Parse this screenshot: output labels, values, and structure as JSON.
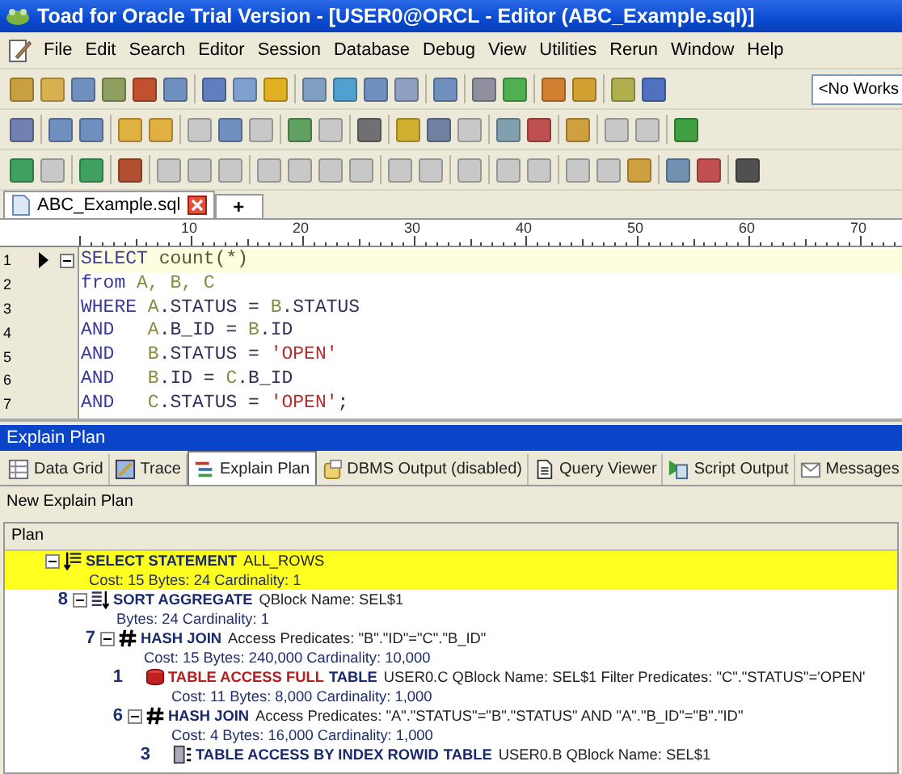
{
  "window": {
    "title": "Toad for Oracle Trial Version - [USER0@ORCL - Editor (ABC_Example.sql)]"
  },
  "menu": [
    "File",
    "Edit",
    "Search",
    "Editor",
    "Session",
    "Database",
    "Debug",
    "View",
    "Utilities",
    "Rerun",
    "Window",
    "Help"
  ],
  "workspace_combo": {
    "value": "<No Works"
  },
  "editor_tabs": [
    {
      "label": "ABC_Example.sql",
      "selected": true
    }
  ],
  "new_tab": {
    "label": "+"
  },
  "ruler": [
    "10",
    "20",
    "30",
    "40",
    "50",
    "60",
    "70"
  ],
  "sql_lines": [
    {
      "number": "1",
      "current": true,
      "tokens": [
        {
          "t": "SELECT",
          "kind": "kw"
        },
        {
          "t": " count(*)",
          "kind": "fn"
        }
      ]
    },
    {
      "number": "2",
      "current": false,
      "tokens": [
        {
          "t": "from",
          "kind": "kw"
        },
        {
          "t": " A, B, C",
          "kind": "id"
        }
      ]
    },
    {
      "number": "3",
      "current": false,
      "tokens": [
        {
          "t": "WHERE",
          "kind": "kw"
        },
        {
          "t": " A",
          "kind": "id"
        },
        {
          "t": ".STATUS = ",
          "kind": "col"
        },
        {
          "t": "B",
          "kind": "id"
        },
        {
          "t": ".STATUS",
          "kind": "col"
        }
      ]
    },
    {
      "number": "4",
      "current": false,
      "tokens": [
        {
          "t": "AND",
          "kind": "kw"
        },
        {
          "t": "   A",
          "kind": "id"
        },
        {
          "t": ".B_ID = ",
          "kind": "col"
        },
        {
          "t": "B",
          "kind": "id"
        },
        {
          "t": ".ID",
          "kind": "col"
        }
      ]
    },
    {
      "number": "5",
      "current": false,
      "tokens": [
        {
          "t": "AND",
          "kind": "kw"
        },
        {
          "t": "   B",
          "kind": "id"
        },
        {
          "t": ".STATUS = ",
          "kind": "col"
        },
        {
          "t": "'OPEN'",
          "kind": "str"
        }
      ]
    },
    {
      "number": "6",
      "current": false,
      "tokens": [
        {
          "t": "AND",
          "kind": "kw"
        },
        {
          "t": "   B",
          "kind": "id"
        },
        {
          "t": ".ID = ",
          "kind": "col"
        },
        {
          "t": "C",
          "kind": "id"
        },
        {
          "t": ".B_ID",
          "kind": "col"
        }
      ]
    },
    {
      "number": "7",
      "current": false,
      "tokens": [
        {
          "t": "AND",
          "kind": "kw"
        },
        {
          "t": "   C",
          "kind": "id"
        },
        {
          "t": ".STATUS = ",
          "kind": "col"
        },
        {
          "t": "'OPEN'",
          "kind": "str"
        },
        {
          "t": ";",
          "kind": "col"
        }
      ]
    }
  ],
  "panel": {
    "title": "Explain Plan"
  },
  "result_tabs": [
    {
      "label": "Data Grid",
      "selected": false,
      "kind": "grid"
    },
    {
      "label": "Trace",
      "selected": false,
      "kind": "trace"
    },
    {
      "label": "Explain Plan",
      "selected": true,
      "kind": "plan"
    },
    {
      "label": "DBMS Output (disabled)",
      "selected": false,
      "kind": "dbms"
    },
    {
      "label": "Query Viewer",
      "selected": false,
      "kind": "doc"
    },
    {
      "label": "Script Output",
      "selected": false,
      "kind": "script"
    },
    {
      "label": "Messages",
      "selected": false,
      "kind": "msg"
    }
  ],
  "plan_caption": "New Explain Plan",
  "plan_header": "Plan",
  "plan": [
    {
      "kind": "select",
      "operation": "SELECT STATEMENT",
      "warn": false,
      "details": "ALL_ROWS",
      "stats": "Cost: 15  Bytes: 24  Cardinality: 1",
      "selected": true,
      "children": [
        {
          "step": "8",
          "kind": "sort",
          "operation": "SORT AGGREGATE",
          "warn": false,
          "details": "QBlock Name: SEL$1",
          "stats": "Bytes: 24  Cardinality: 1",
          "selected": false,
          "children": [
            {
              "step": "7",
              "kind": "hash",
              "operation": "HASH JOIN",
              "warn": false,
              "details": "Access Predicates: \"B\".\"ID\"=\"C\".\"B_ID\"",
              "stats": "Cost: 15  Bytes: 240,000  Cardinality: 10,000",
              "selected": false,
              "children": [
                {
                  "step": "1",
                  "kind": "full",
                  "operation": "TABLE ACCESS FULL",
                  "warn": true,
                  "object": "TABLE",
                  "details": "USER0.C QBlock Name: SEL$1  Filter Predicates: \"C\".\"STATUS\"='OPEN'",
                  "stats": "Cost: 11  Bytes: 8,000  Cardinality: 1,000",
                  "selected": false
                },
                {
                  "step": "6",
                  "kind": "hash",
                  "operation": "HASH JOIN",
                  "warn": false,
                  "details": "Access Predicates: \"A\".\"STATUS\"=\"B\".\"STATUS\" AND \"A\".\"B_ID\"=\"B\".\"ID\"",
                  "stats": "Cost: 4  Bytes: 16,000  Cardinality: 1,000",
                  "selected": false,
                  "children": [
                    {
                      "step": "3",
                      "kind": "index",
                      "operation": "TABLE ACCESS BY INDEX ROWID",
                      "warn": false,
                      "object": "TABLE",
                      "details": "USER0.B QBlock Name: SEL$1",
                      "selected": false
                    }
                  ]
                }
              ]
            }
          ]
        }
      ]
    }
  ]
}
